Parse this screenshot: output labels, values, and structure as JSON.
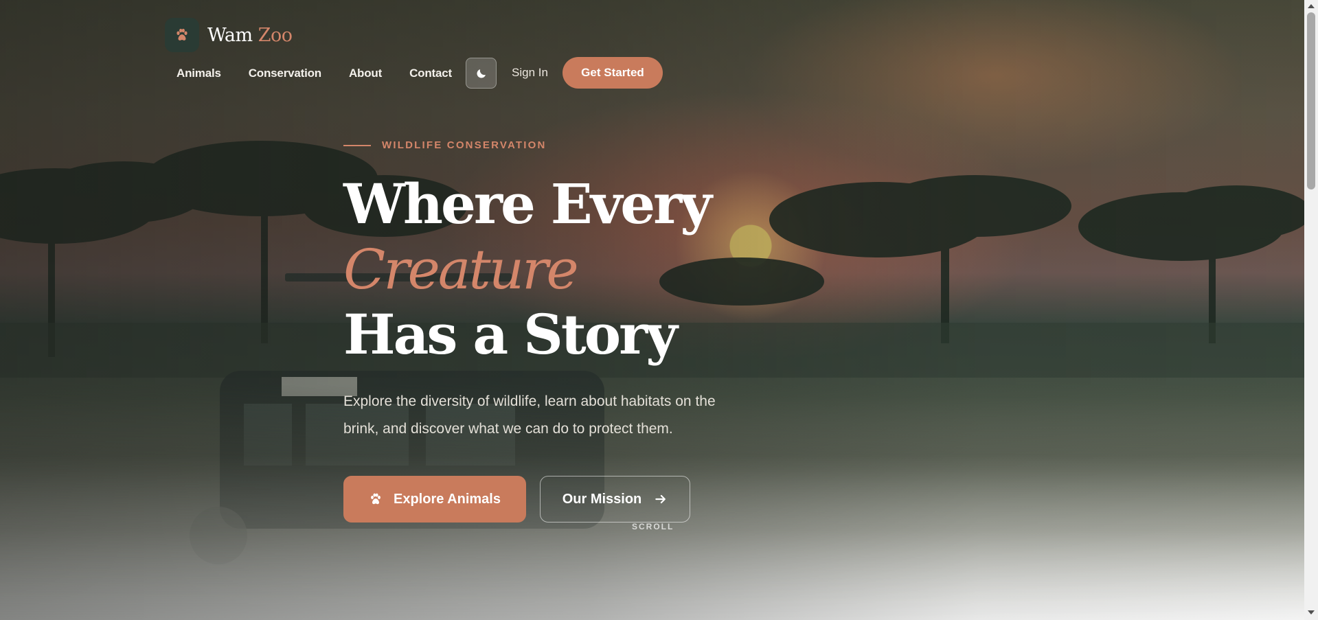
{
  "brand": {
    "name": "Wam",
    "accent": "Zoo",
    "icon": "paw-icon"
  },
  "nav": {
    "links": [
      "Animals",
      "Conservation",
      "About",
      "Contact"
    ],
    "theme_icon": "moon-icon",
    "signin_label": "Sign In",
    "cta_label": "Get Started"
  },
  "hero": {
    "eyebrow": "WILDLIFE CONSERVATION",
    "headline": {
      "line1": "Where Every",
      "line2": "Creature",
      "line3": "Has a Story"
    },
    "subtext": "Explore the diversity of wildlife, learn about habitats on the brink, and discover what we can do to protect them.",
    "primary_button": {
      "label": "Explore Animals",
      "icon": "paw-icon"
    },
    "secondary_button": {
      "label": "Our Mission",
      "icon": "arrow-right-icon"
    },
    "scroll_label": "SCROLL"
  },
  "colors": {
    "accent": "#d4866a",
    "button": "#c97b5c",
    "logo_bg": "#2a3b34"
  }
}
